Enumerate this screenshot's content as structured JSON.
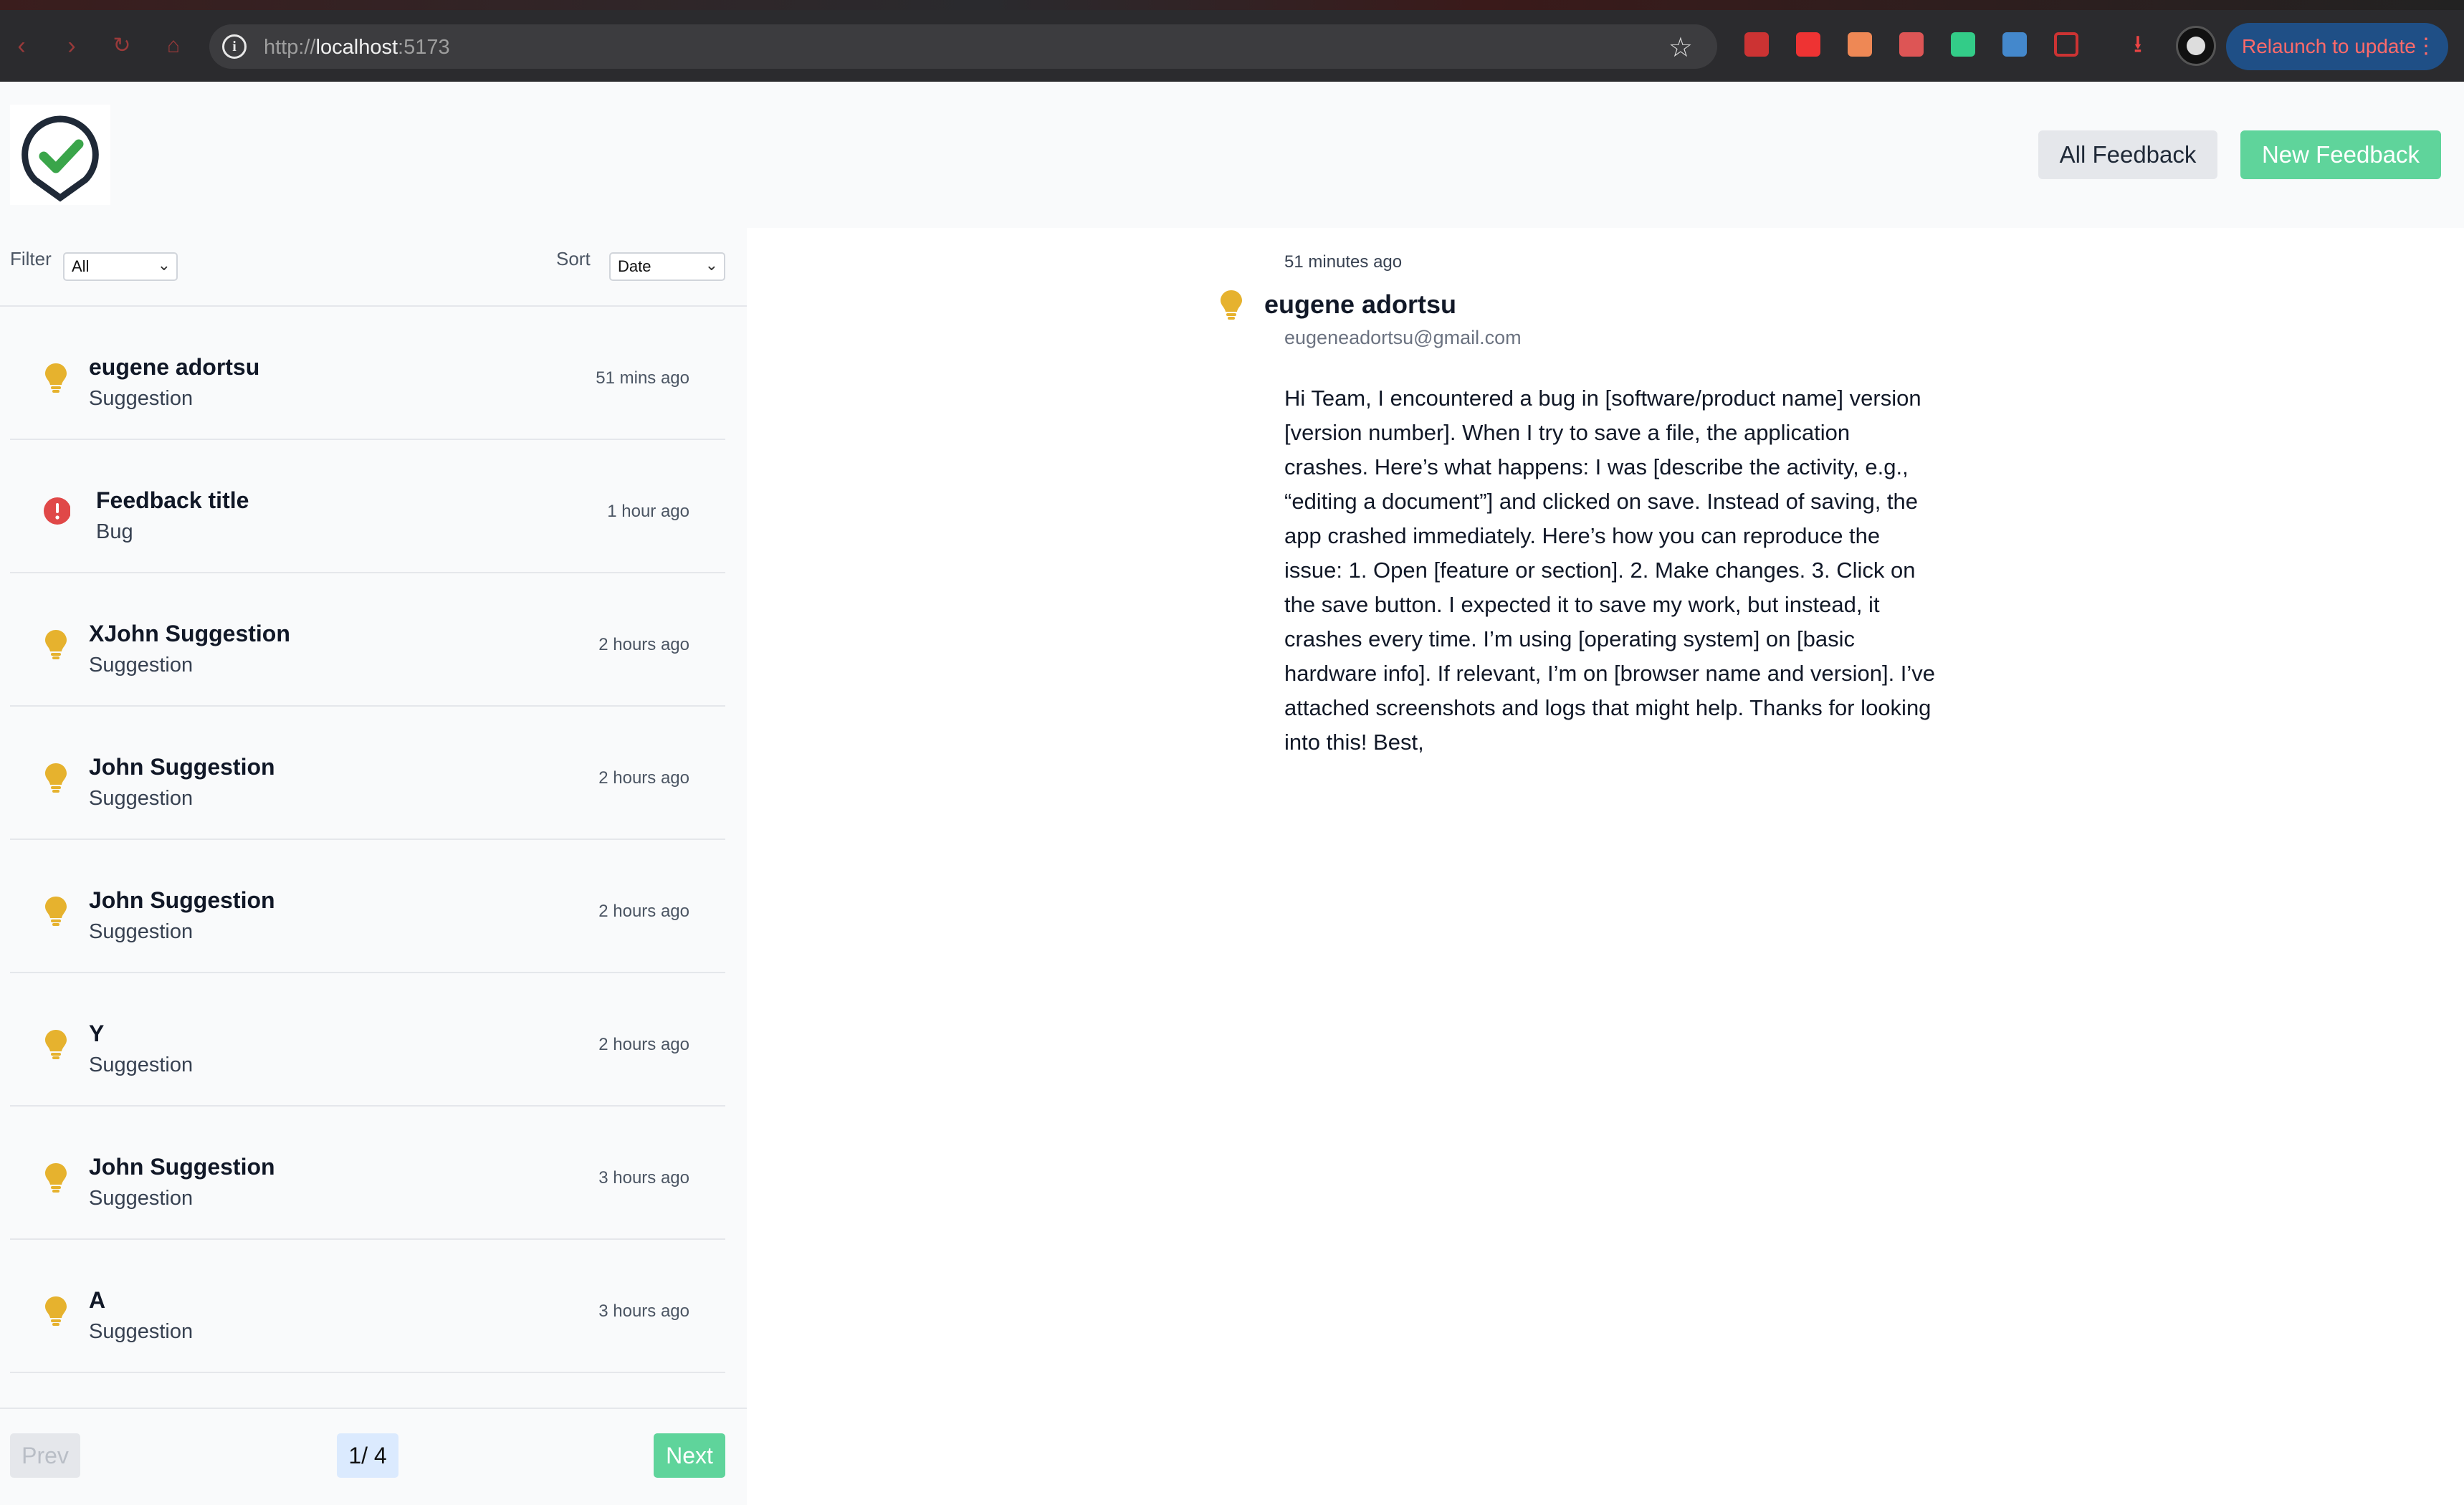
{
  "browser": {
    "url_host": "localhost",
    "url_prefix": "http://",
    "url_suffix": ":5173",
    "relaunch_label": "Relaunch to update"
  },
  "header": {
    "all_feedback_label": "All Feedback",
    "new_feedback_label": "New Feedback"
  },
  "controls": {
    "filter_label": "Filter",
    "filter_value": "All",
    "sort_label": "Sort",
    "sort_value": "Date"
  },
  "items": [
    {
      "title": "eugene adortsu",
      "type": "Suggestion",
      "time": "51 mins ago",
      "icon": "lightbulb-icon"
    },
    {
      "title": "Feedback title",
      "type": "Bug",
      "time": "1 hour ago",
      "icon": "alert-circle-icon"
    },
    {
      "title": "XJohn Suggestion",
      "type": "Suggestion",
      "time": "2 hours ago",
      "icon": "lightbulb-icon"
    },
    {
      "title": "John Suggestion",
      "type": "Suggestion",
      "time": "2 hours ago",
      "icon": "lightbulb-icon"
    },
    {
      "title": "John Suggestion",
      "type": "Suggestion",
      "time": "2 hours ago",
      "icon": "lightbulb-icon"
    },
    {
      "title": "Y",
      "type": "Suggestion",
      "time": "2 hours ago",
      "icon": "lightbulb-icon"
    },
    {
      "title": "John Suggestion",
      "type": "Suggestion",
      "time": "3 hours ago",
      "icon": "lightbulb-icon"
    },
    {
      "title": "A",
      "type": "Suggestion",
      "time": "3 hours ago",
      "icon": "lightbulb-icon"
    }
  ],
  "pagination": {
    "prev_label": "Prev",
    "page_indicator": "1/ 4",
    "next_label": "Next"
  },
  "detail": {
    "time": "51 minutes ago",
    "name": "eugene adortsu",
    "email": "eugeneadortsu@gmail.com",
    "body": "Hi Team, I encountered a bug in [software/product name] version [version number]. When I try to save a file, the application crashes. Here’s what happens: I was [describe the activity, e.g., “editing a document”] and clicked on save. Instead of saving, the app crashed immediately. Here’s how you can reproduce the issue: 1. Open [feature or section]. 2. Make changes. 3. Click on the save button. I expected it to save my work, but instead, it crashes every time. I’m using [operating system] on [basic hardware info]. If relevant, I’m on [browser name and version]. I’ve attached screenshots and logs that might help. Thanks for looking into this! Best,"
  },
  "colors": {
    "accent_green": "#5fd49b",
    "suggestion_yellow": "#e6b22e",
    "bug_red": "#e04848",
    "page_bg": "#f9fafb"
  }
}
